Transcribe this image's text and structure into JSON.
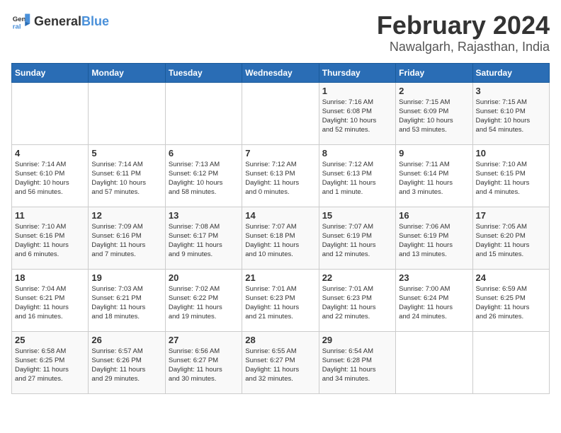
{
  "header": {
    "logo_general": "General",
    "logo_blue": "Blue",
    "month_title": "February 2024",
    "location": "Nawalgarh, Rajasthan, India"
  },
  "days_of_week": [
    "Sunday",
    "Monday",
    "Tuesday",
    "Wednesday",
    "Thursday",
    "Friday",
    "Saturday"
  ],
  "weeks": [
    [
      {
        "day": "",
        "info": ""
      },
      {
        "day": "",
        "info": ""
      },
      {
        "day": "",
        "info": ""
      },
      {
        "day": "",
        "info": ""
      },
      {
        "day": "1",
        "info": "Sunrise: 7:16 AM\nSunset: 6:08 PM\nDaylight: 10 hours\nand 52 minutes."
      },
      {
        "day": "2",
        "info": "Sunrise: 7:15 AM\nSunset: 6:09 PM\nDaylight: 10 hours\nand 53 minutes."
      },
      {
        "day": "3",
        "info": "Sunrise: 7:15 AM\nSunset: 6:10 PM\nDaylight: 10 hours\nand 54 minutes."
      }
    ],
    [
      {
        "day": "4",
        "info": "Sunrise: 7:14 AM\nSunset: 6:10 PM\nDaylight: 10 hours\nand 56 minutes."
      },
      {
        "day": "5",
        "info": "Sunrise: 7:14 AM\nSunset: 6:11 PM\nDaylight: 10 hours\nand 57 minutes."
      },
      {
        "day": "6",
        "info": "Sunrise: 7:13 AM\nSunset: 6:12 PM\nDaylight: 10 hours\nand 58 minutes."
      },
      {
        "day": "7",
        "info": "Sunrise: 7:12 AM\nSunset: 6:13 PM\nDaylight: 11 hours\nand 0 minutes."
      },
      {
        "day": "8",
        "info": "Sunrise: 7:12 AM\nSunset: 6:13 PM\nDaylight: 11 hours\nand 1 minute."
      },
      {
        "day": "9",
        "info": "Sunrise: 7:11 AM\nSunset: 6:14 PM\nDaylight: 11 hours\nand 3 minutes."
      },
      {
        "day": "10",
        "info": "Sunrise: 7:10 AM\nSunset: 6:15 PM\nDaylight: 11 hours\nand 4 minutes."
      }
    ],
    [
      {
        "day": "11",
        "info": "Sunrise: 7:10 AM\nSunset: 6:16 PM\nDaylight: 11 hours\nand 6 minutes."
      },
      {
        "day": "12",
        "info": "Sunrise: 7:09 AM\nSunset: 6:16 PM\nDaylight: 11 hours\nand 7 minutes."
      },
      {
        "day": "13",
        "info": "Sunrise: 7:08 AM\nSunset: 6:17 PM\nDaylight: 11 hours\nand 9 minutes."
      },
      {
        "day": "14",
        "info": "Sunrise: 7:07 AM\nSunset: 6:18 PM\nDaylight: 11 hours\nand 10 minutes."
      },
      {
        "day": "15",
        "info": "Sunrise: 7:07 AM\nSunset: 6:19 PM\nDaylight: 11 hours\nand 12 minutes."
      },
      {
        "day": "16",
        "info": "Sunrise: 7:06 AM\nSunset: 6:19 PM\nDaylight: 11 hours\nand 13 minutes."
      },
      {
        "day": "17",
        "info": "Sunrise: 7:05 AM\nSunset: 6:20 PM\nDaylight: 11 hours\nand 15 minutes."
      }
    ],
    [
      {
        "day": "18",
        "info": "Sunrise: 7:04 AM\nSunset: 6:21 PM\nDaylight: 11 hours\nand 16 minutes."
      },
      {
        "day": "19",
        "info": "Sunrise: 7:03 AM\nSunset: 6:21 PM\nDaylight: 11 hours\nand 18 minutes."
      },
      {
        "day": "20",
        "info": "Sunrise: 7:02 AM\nSunset: 6:22 PM\nDaylight: 11 hours\nand 19 minutes."
      },
      {
        "day": "21",
        "info": "Sunrise: 7:01 AM\nSunset: 6:23 PM\nDaylight: 11 hours\nand 21 minutes."
      },
      {
        "day": "22",
        "info": "Sunrise: 7:01 AM\nSunset: 6:23 PM\nDaylight: 11 hours\nand 22 minutes."
      },
      {
        "day": "23",
        "info": "Sunrise: 7:00 AM\nSunset: 6:24 PM\nDaylight: 11 hours\nand 24 minutes."
      },
      {
        "day": "24",
        "info": "Sunrise: 6:59 AM\nSunset: 6:25 PM\nDaylight: 11 hours\nand 26 minutes."
      }
    ],
    [
      {
        "day": "25",
        "info": "Sunrise: 6:58 AM\nSunset: 6:25 PM\nDaylight: 11 hours\nand 27 minutes."
      },
      {
        "day": "26",
        "info": "Sunrise: 6:57 AM\nSunset: 6:26 PM\nDaylight: 11 hours\nand 29 minutes."
      },
      {
        "day": "27",
        "info": "Sunrise: 6:56 AM\nSunset: 6:27 PM\nDaylight: 11 hours\nand 30 minutes."
      },
      {
        "day": "28",
        "info": "Sunrise: 6:55 AM\nSunset: 6:27 PM\nDaylight: 11 hours\nand 32 minutes."
      },
      {
        "day": "29",
        "info": "Sunrise: 6:54 AM\nSunset: 6:28 PM\nDaylight: 11 hours\nand 34 minutes."
      },
      {
        "day": "",
        "info": ""
      },
      {
        "day": "",
        "info": ""
      }
    ]
  ]
}
